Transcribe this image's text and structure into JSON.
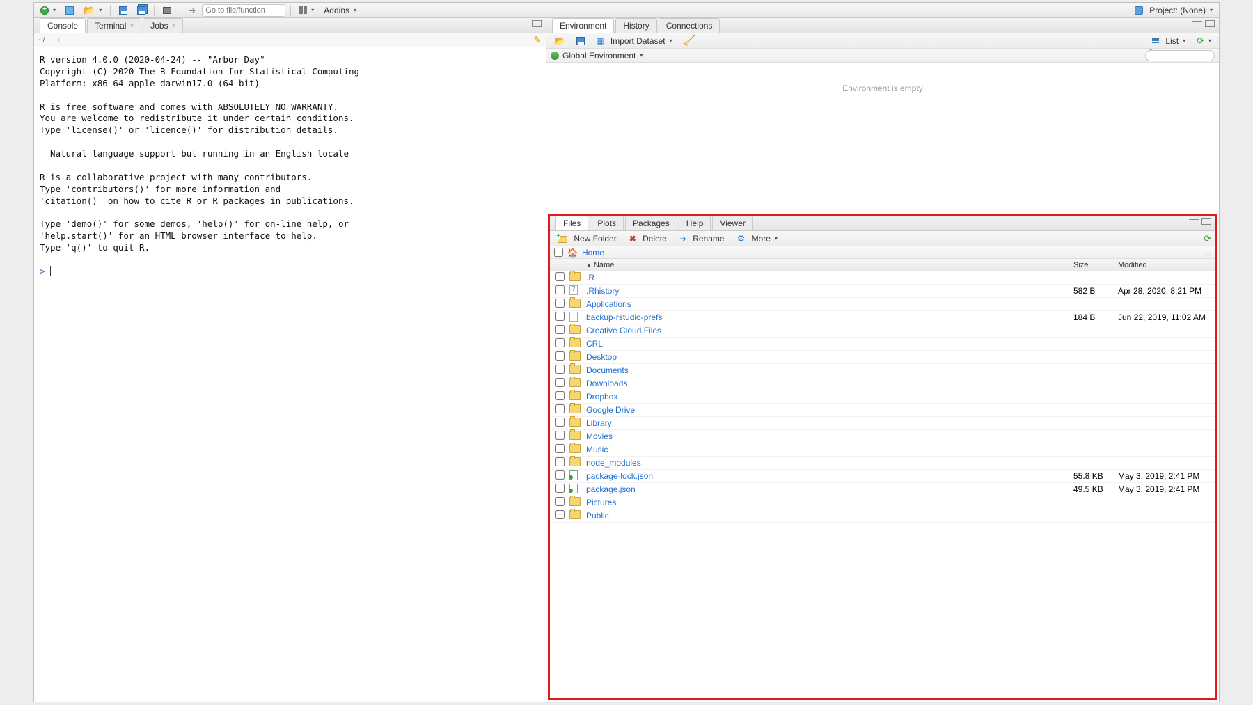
{
  "topbar": {
    "goto_placeholder": "Go to file/function",
    "addins_label": "Addins",
    "project_label": "Project: (None)"
  },
  "console": {
    "tabs": {
      "console": "Console",
      "terminal": "Terminal",
      "jobs": "Jobs"
    },
    "path": "~/",
    "text": "R version 4.0.0 (2020-04-24) -- \"Arbor Day\"\nCopyright (C) 2020 The R Foundation for Statistical Computing\nPlatform: x86_64-apple-darwin17.0 (64-bit)\n\nR is free software and comes with ABSOLUTELY NO WARRANTY.\nYou are welcome to redistribute it under certain conditions.\nType 'license()' or 'licence()' for distribution details.\n\n  Natural language support but running in an English locale\n\nR is a collaborative project with many contributors.\nType 'contributors()' for more information and\n'citation()' on how to cite R or R packages in publications.\n\nType 'demo()' for some demos, 'help()' for on-line help, or\n'help.start()' for an HTML browser interface to help.\nType 'q()' to quit R.\n",
    "prompt": ">"
  },
  "env": {
    "tabs": {
      "environment": "Environment",
      "history": "History",
      "connections": "Connections"
    },
    "import_label": "Import Dataset",
    "list_label": "List",
    "scope_label": "Global Environment",
    "empty_msg": "Environment is empty"
  },
  "files": {
    "tabs": {
      "files": "Files",
      "plots": "Plots",
      "packages": "Packages",
      "help": "Help",
      "viewer": "Viewer"
    },
    "toolbar": {
      "newfolder": "New Folder",
      "delete": "Delete",
      "rename": "Rename",
      "more": "More"
    },
    "breadcrumb": "Home",
    "columns": {
      "name": "Name",
      "size": "Size",
      "modified": "Modified"
    },
    "rows": [
      {
        "icon": "folder",
        "name": ".R",
        "size": "",
        "modified": ""
      },
      {
        "icon": "filer",
        "name": ".Rhistory",
        "size": "582 B",
        "modified": "Apr 28, 2020, 8:21 PM"
      },
      {
        "icon": "folder",
        "name": "Applications",
        "size": "",
        "modified": ""
      },
      {
        "icon": "file",
        "name": "backup-rstudio-prefs",
        "size": "184 B",
        "modified": "Jun 22, 2019, 11:02 AM"
      },
      {
        "icon": "folder",
        "name": "Creative Cloud Files",
        "size": "",
        "modified": ""
      },
      {
        "icon": "folder",
        "name": "CRL",
        "size": "",
        "modified": ""
      },
      {
        "icon": "folder",
        "name": "Desktop",
        "size": "",
        "modified": ""
      },
      {
        "icon": "folder",
        "name": "Documents",
        "size": "",
        "modified": ""
      },
      {
        "icon": "folder",
        "name": "Downloads",
        "size": "",
        "modified": ""
      },
      {
        "icon": "folder",
        "name": "Dropbox",
        "size": "",
        "modified": ""
      },
      {
        "icon": "folder",
        "name": "Google Drive",
        "size": "",
        "modified": ""
      },
      {
        "icon": "folder",
        "name": "Library",
        "size": "",
        "modified": ""
      },
      {
        "icon": "folder",
        "name": "Movies",
        "size": "",
        "modified": ""
      },
      {
        "icon": "folder",
        "name": "Music",
        "size": "",
        "modified": ""
      },
      {
        "icon": "folder",
        "name": "node_modules",
        "size": "",
        "modified": ""
      },
      {
        "icon": "json",
        "name": "package-lock.json",
        "size": "55.8 KB",
        "modified": "May 3, 2019, 2:41 PM"
      },
      {
        "icon": "json",
        "name": "package.json",
        "size": "49.5 KB",
        "modified": "May 3, 2019, 2:41 PM",
        "under": true
      },
      {
        "icon": "folder",
        "name": "Pictures",
        "size": "",
        "modified": ""
      },
      {
        "icon": "folder",
        "name": "Public",
        "size": "",
        "modified": ""
      }
    ]
  }
}
